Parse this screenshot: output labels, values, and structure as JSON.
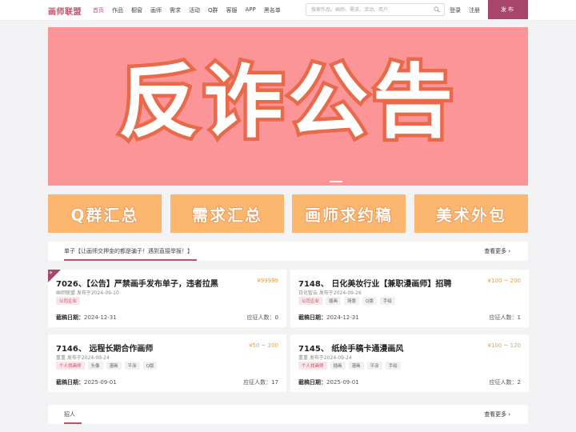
{
  "header": {
    "logo": "画师联盟",
    "nav": [
      {
        "label": "首页",
        "active": true
      },
      {
        "label": "作品",
        "active": false
      },
      {
        "label": "橱窗",
        "active": false
      },
      {
        "label": "画师",
        "active": false
      },
      {
        "label": "需求",
        "active": false
      },
      {
        "label": "活动",
        "active": false
      },
      {
        "label": "Q群",
        "active": false
      },
      {
        "label": "客服",
        "active": false
      },
      {
        "label": "APP",
        "active": false
      },
      {
        "label": "黑名单",
        "active": false
      }
    ],
    "search_placeholder": "搜索作品、画师、需求、活动、用户",
    "login": "登录",
    "register": "注册",
    "publish": "发布"
  },
  "banner": {
    "text": "反诈公告",
    "bg_color": "#fb9598"
  },
  "tiles": [
    {
      "label": "Q群汇总"
    },
    {
      "label": "需求汇总"
    },
    {
      "label": "画师求约稿"
    },
    {
      "label": "美术外包"
    }
  ],
  "orders_section": {
    "title": "单子【让画师交押金的都是骗子！遇到直接举报！】",
    "more": "查看更多"
  },
  "cards": [
    {
      "title": "7026、【公告】严禁画手发布单子，违者拉黑",
      "price": "¥99999",
      "meta": "画师联盟 发布于2024-09-10",
      "tags": [
        "公司企业"
      ],
      "deadline_label": "截稿日期：",
      "deadline": "2024-12-31",
      "applicants": "应征人数：0",
      "pinned": true
    },
    {
      "title": "7148、 日化美妆行业【兼职漫画师】招聘",
      "price": "¥100 ~ 200",
      "meta": "日化智云 发布于2024-09-26",
      "tags": [
        "公司企业",
        "插画",
        "场景",
        "Q版",
        "手绘"
      ],
      "deadline_label": "截稿日期：",
      "deadline": "2024-12-31",
      "applicants": "应征人数：1",
      "pinned": false
    },
    {
      "title": "7146、 远程长期合作画师",
      "price": "¥50 ~ 200",
      "meta": "重重 发布于2024-09-24",
      "tags": [
        "个人找画师",
        "头像",
        "漫画",
        "平涂",
        "Q版"
      ],
      "deadline_label": "截稿日期：",
      "deadline": "2025-09-01",
      "applicants": "应征人数：17",
      "pinned": false
    },
    {
      "title": "7145、 纸绘手稿卡通漫画风",
      "price": "¥100 ~ 120",
      "meta": "重重 发布于2024-09-24",
      "tags": [
        "个人找画师",
        "插画",
        "漫画",
        "平涂",
        "手绘"
      ],
      "deadline_label": "截稿日期：",
      "deadline": "2025-09-01",
      "applicants": "应征人数：2",
      "pinned": false
    }
  ],
  "recruit_section": {
    "title": "招人",
    "more": "查看更多"
  },
  "colors": {
    "brand": "#c2506c",
    "publish_bg": "#a8456a",
    "tile_bg": "#fbb76e",
    "price": "#e0a24a"
  }
}
